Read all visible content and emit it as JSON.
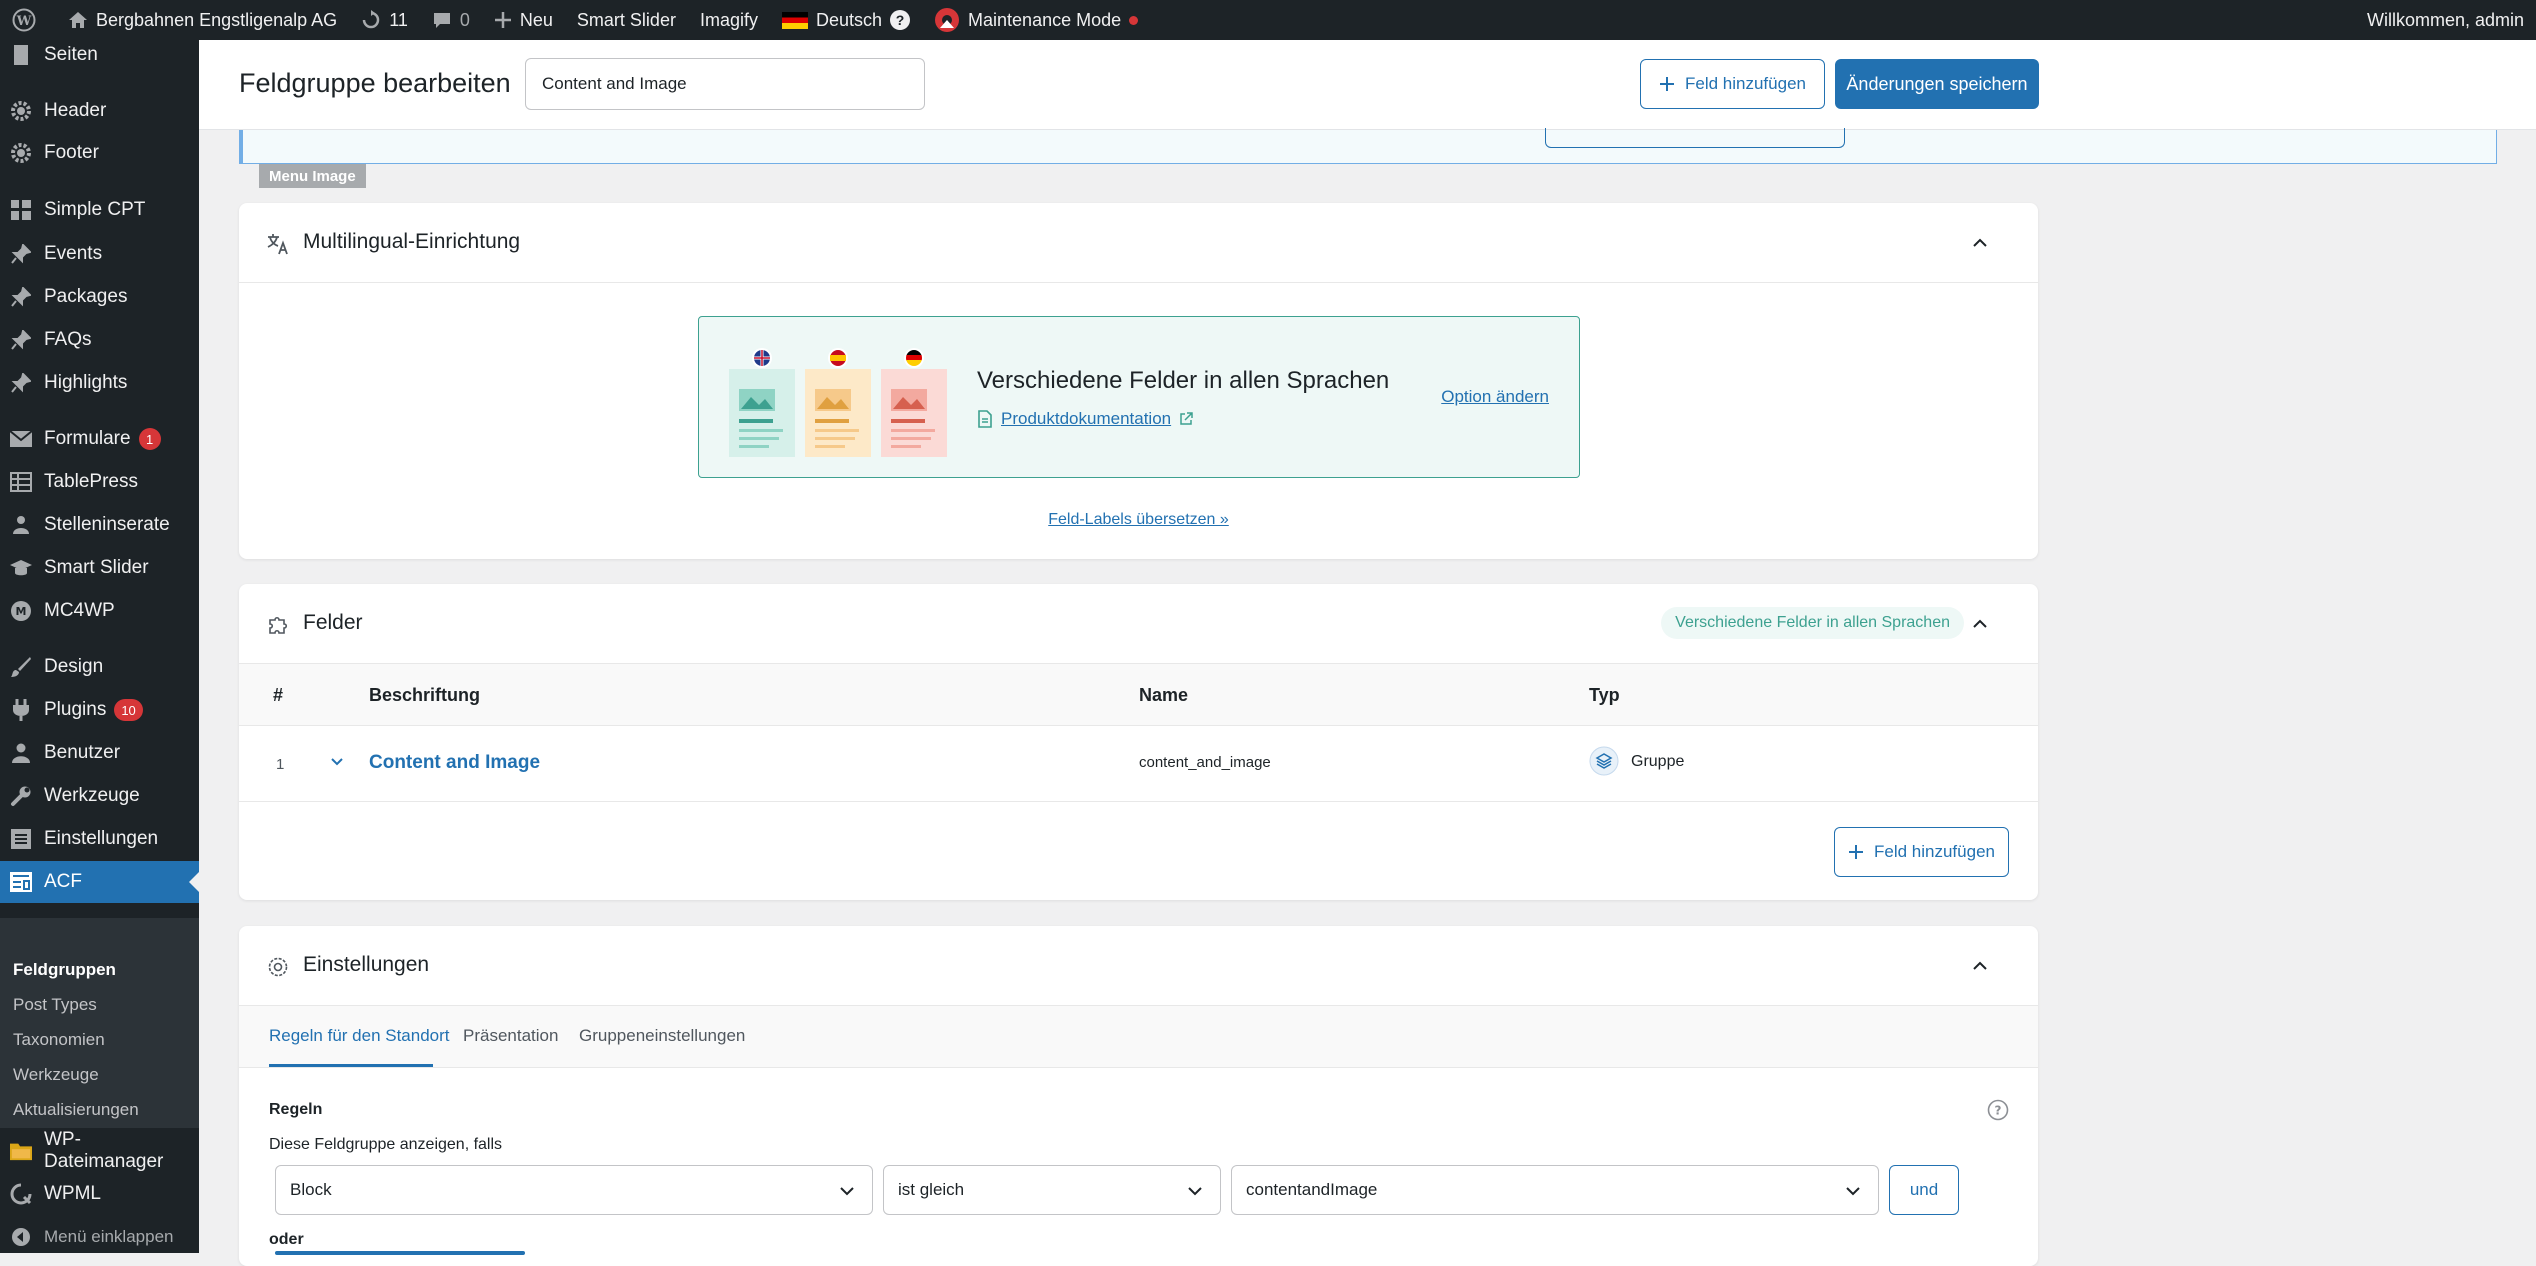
{
  "adminbar": {
    "site_name": "Bergbahnen Engstligenalp AG",
    "updates_count": "11",
    "comments_count": "0",
    "new_label": "Neu",
    "smart_slider": "Smart Slider",
    "imagify": "Imagify",
    "language": "Deutsch",
    "help": "?",
    "maintenance": "Maintenance Mode",
    "welcome": "Willkommen, admin"
  },
  "sidebar": {
    "items": [
      {
        "label": "Seiten",
        "icon": "page-icon"
      },
      {
        "label": "Header",
        "icon": "gear-icon"
      },
      {
        "label": "Footer",
        "icon": "gear-icon"
      },
      {
        "label": "Simple CPT",
        "icon": "grid-icon"
      },
      {
        "label": "Events",
        "icon": "pin-icon"
      },
      {
        "label": "Packages",
        "icon": "pin-icon"
      },
      {
        "label": "FAQs",
        "icon": "pin-icon"
      },
      {
        "label": "Highlights",
        "icon": "pin-icon"
      },
      {
        "label": "Formulare",
        "icon": "envelope-icon",
        "badge": "1"
      },
      {
        "label": "TablePress",
        "icon": "table-icon"
      },
      {
        "label": "Stelleninserate",
        "icon": "people-icon"
      },
      {
        "label": "Smart Slider",
        "icon": "cap-icon"
      },
      {
        "label": "MC4WP",
        "icon": "mc4wp-icon"
      },
      {
        "label": "Design",
        "icon": "brush-icon"
      },
      {
        "label": "Plugins",
        "icon": "plug-icon",
        "badge": "10"
      },
      {
        "label": "Benutzer",
        "icon": "user-icon"
      },
      {
        "label": "Werkzeuge",
        "icon": "wrench-icon"
      },
      {
        "label": "Einstellungen",
        "icon": "settings-icon"
      },
      {
        "label": "ACF",
        "icon": "acf-icon"
      }
    ],
    "submenu": [
      "Feldgruppen",
      "Post Types",
      "Taxonomien",
      "Werkzeuge",
      "Aktualisierungen"
    ],
    "bottom_items": [
      {
        "label": "WP-Dateimanager",
        "icon": "folder-icon"
      },
      {
        "label": "WPML",
        "icon": "wpml-icon"
      }
    ],
    "collapse": "Menü einklappen"
  },
  "header": {
    "title": "Feldgruppe bearbeiten",
    "group_title_value": "Content and Image",
    "add_field": "Feld hinzufügen",
    "save": "Änderungen speichern"
  },
  "notice": {
    "tag": "Menu Image"
  },
  "multilingual": {
    "title": "Multilingual-Einrichtung",
    "heading": "Verschiedene Felder in allen Sprachen",
    "doc_link": "Produktdokumentation",
    "change_option": "Option ändern",
    "translate_labels": "Feld-Labels übersetzen »"
  },
  "fields": {
    "title": "Felder",
    "badge": "Verschiedene Felder in allen Sprachen",
    "columns": [
      "#",
      "Beschriftung",
      "Name",
      "Typ"
    ],
    "rows": [
      {
        "num": "1",
        "label": "Content and Image",
        "name": "content_and_image",
        "type": "Gruppe"
      }
    ],
    "add_field": "Feld hinzufügen"
  },
  "settings": {
    "title": "Einstellungen",
    "tabs": [
      "Regeln für den Standort",
      "Präsentation",
      "Gruppeneinstellungen"
    ],
    "rules_label": "Regeln",
    "show_if": "Diese Feldgruppe anzeigen, falls",
    "rule": {
      "param": "Block",
      "operator": "ist gleich",
      "value": "contentandImage"
    },
    "and_label": "und",
    "or_label": "oder"
  },
  "colors": {
    "accent": "#2271b1",
    "admin_dark": "#1d2327",
    "multilingual_green": "#3da190",
    "badge_red": "#d63638"
  }
}
